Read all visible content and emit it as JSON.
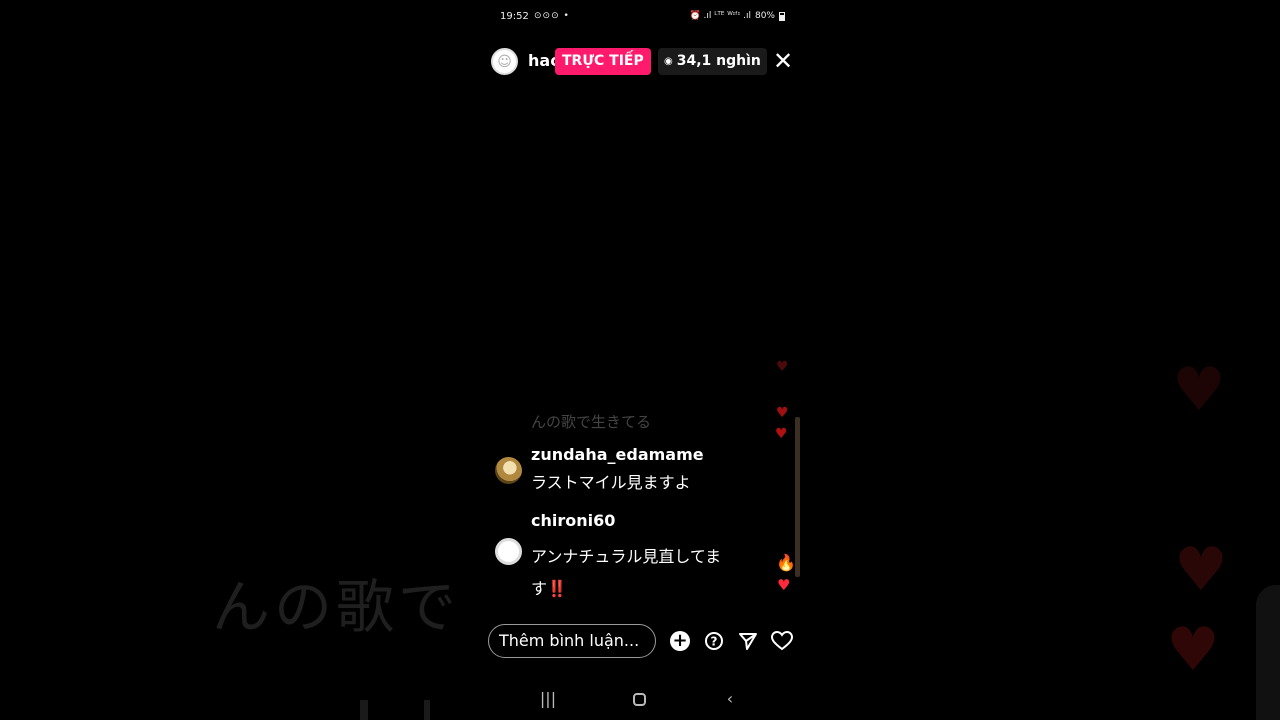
{
  "status_bar": {
    "time": "19:52",
    "notification_icons": "⊙⊙⊙ •",
    "right_icons": "⏰ .ıl ᴸᵀᴱ ᵂᶦᶠᶦ .ıl",
    "battery": "80%"
  },
  "live": {
    "username": "hac",
    "live_badge": "TRỰC TIẾP",
    "viewer_count": "34,1 nghìn",
    "close_symbol": "✕"
  },
  "comments": {
    "faded_previous": "んの歌で生きてる",
    "items": [
      {
        "user": "zundaha_edamame",
        "text": "ラストマイル見ますよ"
      },
      {
        "user": "chironi60",
        "text": "アンナチュラル見直してます",
        "emoji": "‼️"
      }
    ]
  },
  "background": {
    "ghost_text": "んの歌で"
  },
  "bottom_bar": {
    "comment_placeholder": "Thêm bình luận..."
  },
  "icons": {
    "avatar": "user-avatar-icon",
    "eye": "eye-icon",
    "close": "close-icon",
    "plus": "plus-circle-icon",
    "question": "question-icon",
    "send": "send-icon",
    "heart": "heart-icon",
    "fire": "fire-emoji",
    "nav_recent": "recent-apps-icon",
    "nav_home": "home-icon",
    "nav_back": "back-icon"
  },
  "colors": {
    "live_badge": "#ff1a6c",
    "background": "#000000",
    "viewer_badge": "#1a1a1a"
  }
}
